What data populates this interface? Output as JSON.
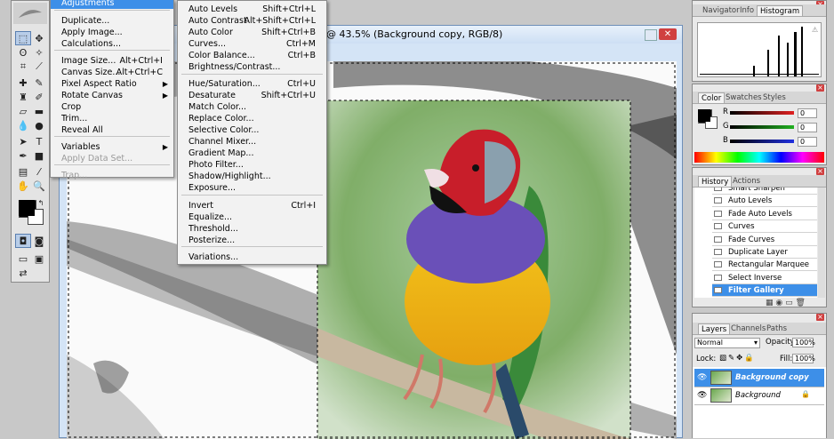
{
  "document": {
    "title": "@ 43.5% (Background copy, RGB/8)"
  },
  "image_menu": {
    "header": "Adjustments",
    "items": [
      {
        "label": "Duplicate...",
        "shortcut": ""
      },
      {
        "label": "Apply Image...",
        "shortcut": ""
      },
      {
        "label": "Calculations...",
        "shortcut": ""
      },
      {
        "label": "Image Size...",
        "shortcut": "Alt+Ctrl+I"
      },
      {
        "label": "Canvas Size...",
        "shortcut": "Alt+Ctrl+C"
      },
      {
        "label": "Pixel Aspect Ratio",
        "shortcut": ""
      },
      {
        "label": "Rotate Canvas",
        "shortcut": ""
      },
      {
        "label": "Crop",
        "shortcut": ""
      },
      {
        "label": "Trim...",
        "shortcut": ""
      },
      {
        "label": "Reveal All",
        "shortcut": ""
      },
      {
        "label": "Variables",
        "shortcut": ""
      },
      {
        "label": "Apply Data Set...",
        "shortcut": ""
      },
      {
        "label": "Trap...",
        "shortcut": ""
      }
    ]
  },
  "adjust_menu": {
    "items": [
      {
        "label": "Auto Levels",
        "shortcut": "Shift+Ctrl+L"
      },
      {
        "label": "Auto Contrast",
        "shortcut": "Alt+Shift+Ctrl+L"
      },
      {
        "label": "Auto Color",
        "shortcut": "Shift+Ctrl+B"
      },
      {
        "label": "Curves...",
        "shortcut": "Ctrl+M"
      },
      {
        "label": "Color Balance...",
        "shortcut": "Ctrl+B"
      },
      {
        "label": "Brightness/Contrast...",
        "shortcut": ""
      },
      {
        "label": "Hue/Saturation...",
        "shortcut": "Ctrl+U"
      },
      {
        "label": "Desaturate",
        "shortcut": "Shift+Ctrl+U"
      },
      {
        "label": "Match Color...",
        "shortcut": ""
      },
      {
        "label": "Replace Color...",
        "shortcut": ""
      },
      {
        "label": "Selective Color...",
        "shortcut": ""
      },
      {
        "label": "Channel Mixer...",
        "shortcut": ""
      },
      {
        "label": "Gradient Map...",
        "shortcut": ""
      },
      {
        "label": "Photo Filter...",
        "shortcut": ""
      },
      {
        "label": "Shadow/Highlight...",
        "shortcut": ""
      },
      {
        "label": "Exposure...",
        "shortcut": ""
      },
      {
        "label": "Invert",
        "shortcut": "Ctrl+I"
      },
      {
        "label": "Equalize...",
        "shortcut": ""
      },
      {
        "label": "Threshold...",
        "shortcut": ""
      },
      {
        "label": "Posterize...",
        "shortcut": ""
      },
      {
        "label": "Variations...",
        "shortcut": ""
      }
    ]
  },
  "navigator_panel": {
    "tabs": [
      "Navigator",
      "Info",
      "Histogram"
    ]
  },
  "color_panel": {
    "tabs": [
      "Color",
      "Swatches",
      "Styles"
    ],
    "channels": [
      {
        "label": "R",
        "value": "0",
        "color": "#e02020"
      },
      {
        "label": "G",
        "value": "0",
        "color": "#20b020"
      },
      {
        "label": "B",
        "value": "0",
        "color": "#2030e0"
      }
    ]
  },
  "history_panel": {
    "tabs": [
      "History",
      "Actions"
    ],
    "items": [
      "Smart Sharpen",
      "Auto Levels",
      "Fade Auto Levels",
      "Curves",
      "Fade Curves",
      "Duplicate Layer",
      "Rectangular Marquee",
      "Select Inverse",
      "Filter Gallery"
    ]
  },
  "layers_panel": {
    "tabs": [
      "Layers",
      "Channels",
      "Paths"
    ],
    "blend_mode": "Normal",
    "opacity_label": "Opacity:",
    "opacity_value": "100%",
    "lock_label": "Lock:",
    "fill_label": "Fill:",
    "fill_value": "100%",
    "layers": [
      "Background copy",
      "Background"
    ]
  },
  "colors": {
    "accent": "#3d8fe8",
    "foreground": "#000000",
    "background": "#ffffff"
  }
}
